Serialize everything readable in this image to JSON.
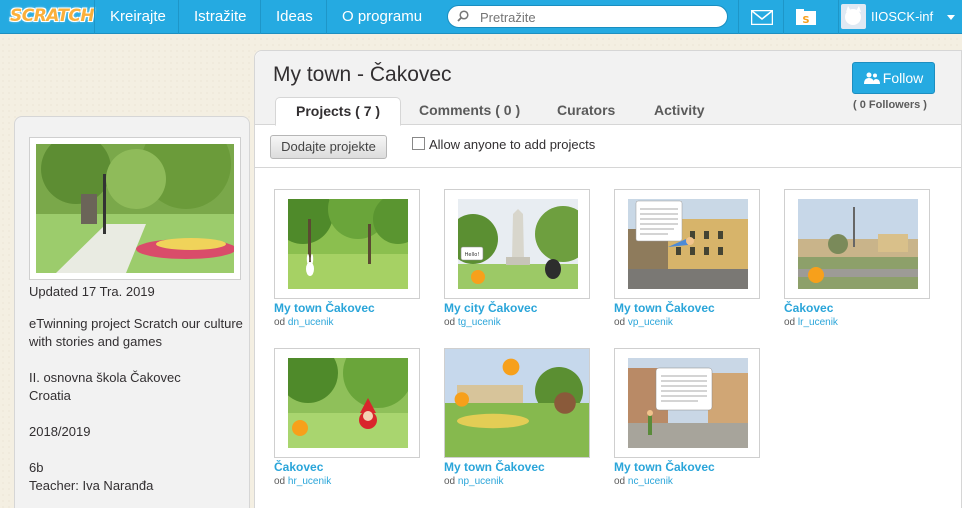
{
  "nav": {
    "logo": "SCRATCH",
    "links": [
      "Kreirajte",
      "Istražite",
      "Ideas",
      "O programu"
    ],
    "search_placeholder": "Pretražite",
    "username": "IIOSCK-inf"
  },
  "studio": {
    "title": "My town - Čakovec",
    "tabs": [
      "Projects ( 7 )",
      "Comments ( 0 )",
      "Curators",
      "Activity"
    ],
    "follow_label": "Follow",
    "followers": "( 0 Followers )",
    "add_button": "Dodajte projekte",
    "allow_label": "Allow anyone to add projects",
    "allow_checked": false
  },
  "sidebar": {
    "updated": "Updated 17 Tra. 2019",
    "description_lines": [
      "eTwinning project Scratch our culture",
      "with stories and games",
      "II. osnovna škola Čakovec",
      "Croatia",
      "2018/2019",
      "6b",
      "Teacher: Iva Naranđa"
    ]
  },
  "projects": [
    {
      "title": "My town Čakovec",
      "by_prefix": "od",
      "author": "dn_ucenik"
    },
    {
      "title": "My city Čakovec",
      "by_prefix": "od",
      "author": "tg_ucenik"
    },
    {
      "title": "My town Čakovec",
      "by_prefix": "od",
      "author": "vp_ucenik"
    },
    {
      "title": "Čakovec",
      "by_prefix": "od",
      "author": "lr_ucenik"
    },
    {
      "title": "Čakovec",
      "by_prefix": "od",
      "author": "hr_ucenik"
    },
    {
      "title": "My town Čakovec",
      "by_prefix": "od",
      "author": "np_ucenik"
    },
    {
      "title": "My town Čakovec",
      "by_prefix": "od",
      "author": "nc_ucenik"
    }
  ],
  "thumb_text": {
    "p2_speech": "Hello!",
    "p3_speech": "Most of the historical buildings in Čakovec are located in the town center or in the centrally located Zrinski park, and the town's historical core has been well preserved.",
    "p7_speech": "Čakovec is a town in northern Croatia, in the county of Međimurje. Čakovec as grad u sjeverniој Hrvatskoj u županiji Međimurje."
  },
  "colors": {
    "nav_blue": "#25aae1",
    "link_blue": "#2aa5d9",
    "scratch_orange": "#fbb03b"
  }
}
